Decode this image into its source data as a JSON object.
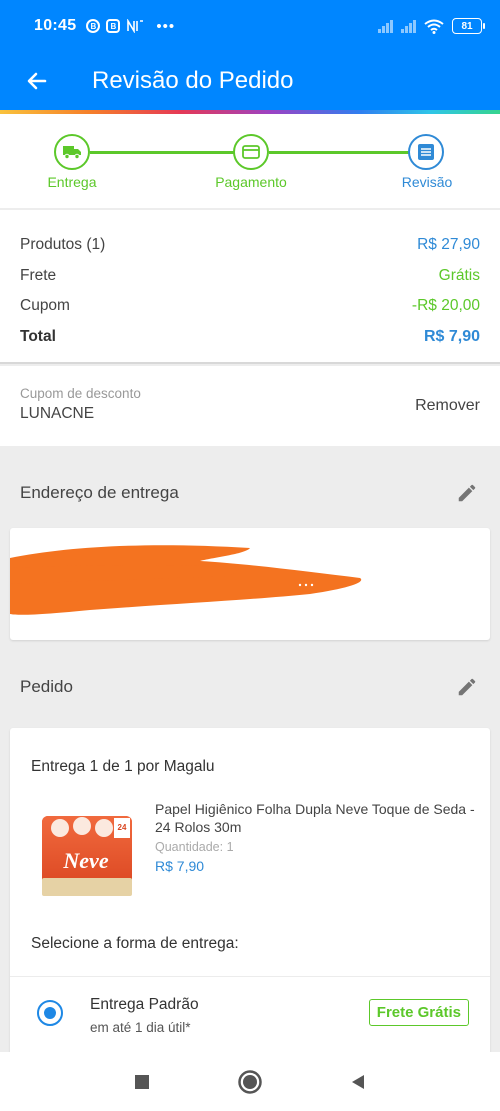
{
  "status_bar": {
    "time": "10:45",
    "icons": [
      "b-circle-icon",
      "b-square-icon",
      "nfc-icon"
    ],
    "dots": "•••",
    "battery": "81"
  },
  "app_bar": {
    "title": "Revisão do Pedido",
    "back_icon": "arrow-left-icon"
  },
  "stepper": {
    "steps": [
      {
        "label": "Entrega",
        "icon": "truck-icon",
        "state": "done"
      },
      {
        "label": "Pagamento",
        "icon": "card-icon",
        "state": "done"
      },
      {
        "label": "Revisão",
        "icon": "list-icon",
        "state": "current"
      }
    ]
  },
  "summary": {
    "products_label": "Produtos (1)",
    "products_value": "R$ 27,90",
    "shipping_label": "Frete",
    "shipping_value": "Grátis",
    "coupon_label": "Cupom",
    "coupon_value": "-R$ 20,00",
    "total_label": "Total",
    "total_value": "R$ 7,90"
  },
  "coupon": {
    "label": "Cupom de desconto",
    "code": "LUNACNE",
    "remove": "Remover"
  },
  "address": {
    "heading": "Endereço de entrega"
  },
  "order": {
    "heading": "Pedido",
    "delivery": "Entrega 1 de 1 por Magalu",
    "product_name": "Papel Higiênico Folha Dupla Neve Toque de Seda - 24 Rolos 30m",
    "quantity": "Quantidade:  1",
    "price": "R$ 7,90",
    "select_label": "Selecione a forma de entrega:",
    "option_title": "Entrega Padrão",
    "option_sub": "em até 1 dia útil*",
    "option_badge": "Frete Grátis"
  },
  "brand": {
    "product_logo": "Neve"
  },
  "colors": {
    "primary": "#0086ff",
    "green": "#5cc82a",
    "blue": "#2f8ad6",
    "redaction": "#f47320"
  }
}
